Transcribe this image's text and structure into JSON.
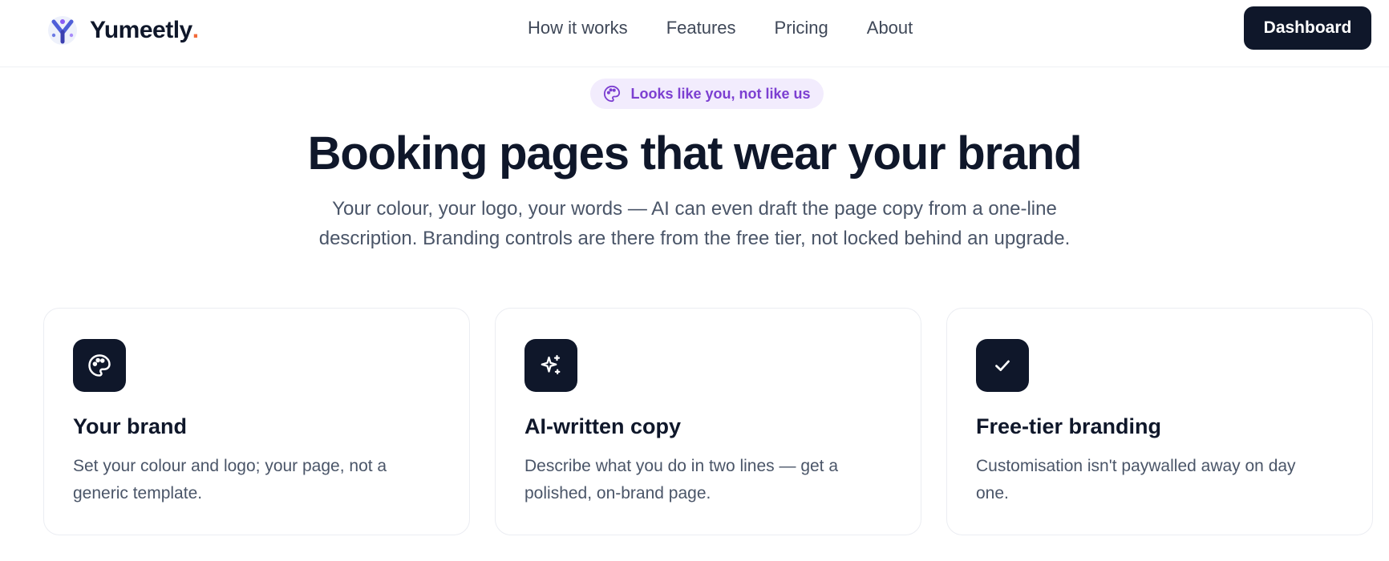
{
  "header": {
    "brand_name": "Yumeetly",
    "brand_dot": ".",
    "nav": [
      {
        "label": "How it works"
      },
      {
        "label": "Features"
      },
      {
        "label": "Pricing"
      },
      {
        "label": "About"
      }
    ],
    "dashboard_label": "Dashboard"
  },
  "hero": {
    "badge": "Looks like you, not like us",
    "badge_icon": "palette-icon",
    "title": "Booking pages that wear your brand",
    "subtitle": "Your colour, your logo, your words — AI can even draft the page copy from a one-line description. Branding controls are there from the free tier, not locked behind an upgrade."
  },
  "cards": [
    {
      "icon": "palette-icon",
      "title": "Your brand",
      "description": "Set your colour and logo; your page, not a generic template."
    },
    {
      "icon": "sparkles-icon",
      "title": "AI-written copy",
      "description": "Describe what you do in two lines — get a polished, on-brand page."
    },
    {
      "icon": "check-icon",
      "title": "Free-tier branding",
      "description": "Customisation isn't paywalled away on day one."
    }
  ],
  "colors": {
    "dark": "#0f172a",
    "accent_purple": "#7c3fd1",
    "badge_bg": "#f2ecfd",
    "brand_dot": "#f26b3a",
    "muted_text": "#4a5568"
  }
}
